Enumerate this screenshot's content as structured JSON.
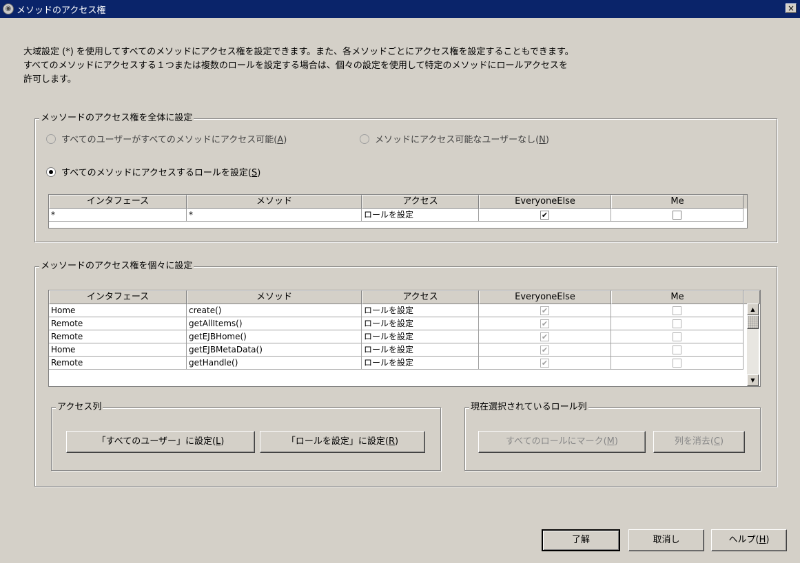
{
  "window": {
    "title": "メソッドのアクセス権",
    "close_label": "×"
  },
  "intro": [
    "大域設定 (*) を使用してすべてのメソッドにアクセス権を設定できます。また、各メソッドごとにアクセス権を設定することもできます。",
    "すべてのメソッドにアクセスする１つまたは複数のロールを設定する場合は、個々の設定を使用して特定のメソッドにロールアクセスを",
    "許可します。"
  ],
  "global": {
    "legend": "メッソードのアクセス権を全体に設定",
    "radio_all_users": {
      "label": "すべてのユーザーがすべてのメソッドにアクセス可能",
      "mnemonic": "A"
    },
    "radio_no_users": {
      "label": "メソッドにアクセス可能なユーザーなし",
      "mnemonic": "N"
    },
    "radio_set_roles": {
      "label": "すべてのメソッドにアクセスするロールを設定",
      "mnemonic": "S"
    },
    "selected": "set_roles",
    "columns": [
      "インタフェース",
      "メソッド",
      "アクセス",
      "EveryoneElse",
      "Me"
    ],
    "rows": [
      {
        "interface": "*",
        "method": "*",
        "access": "ロールを設定",
        "everyone_else": true,
        "me": false
      }
    ]
  },
  "individual": {
    "legend": "メッソードのアクセス権を個々に設定",
    "columns": [
      "インタフェース",
      "メソッド",
      "アクセス",
      "EveryoneElse",
      "Me"
    ],
    "rows": [
      {
        "interface": "Home",
        "method": "create()",
        "access": "ロールを設定",
        "everyone_else": true,
        "me": false
      },
      {
        "interface": "Remote",
        "method": "getAllItems()",
        "access": "ロールを設定",
        "everyone_else": true,
        "me": false
      },
      {
        "interface": "Remote",
        "method": "getEJBHome()",
        "access": "ロールを設定",
        "everyone_else": true,
        "me": false
      },
      {
        "interface": "Home",
        "method": "getEJBMetaData()",
        "access": "ロールを設定",
        "everyone_else": true,
        "me": false
      },
      {
        "interface": "Remote",
        "method": "getHandle()",
        "access": "ロールを設定",
        "everyone_else": true,
        "me": false
      }
    ],
    "access_column_group": {
      "legend": "アクセス列",
      "set_all_users": {
        "label": "「すべてのユーザー」に設定",
        "mnemonic": "L"
      },
      "set_roles": {
        "label": "「ロールを設定」に設定",
        "mnemonic": "R"
      }
    },
    "role_column_group": {
      "legend": "現在選択されているロール列",
      "mark_all": {
        "label": "すべてのロールにマーク",
        "mnemonic": "M"
      },
      "clear_column": {
        "label": "列を消去",
        "mnemonic": "C"
      }
    }
  },
  "footer": {
    "ok": "了解",
    "cancel": "取消し",
    "help": {
      "label": "ヘルプ",
      "mnemonic": "H"
    }
  },
  "icons": {
    "check": "✔",
    "scroll_up": "▲",
    "scroll_down": "▼"
  }
}
